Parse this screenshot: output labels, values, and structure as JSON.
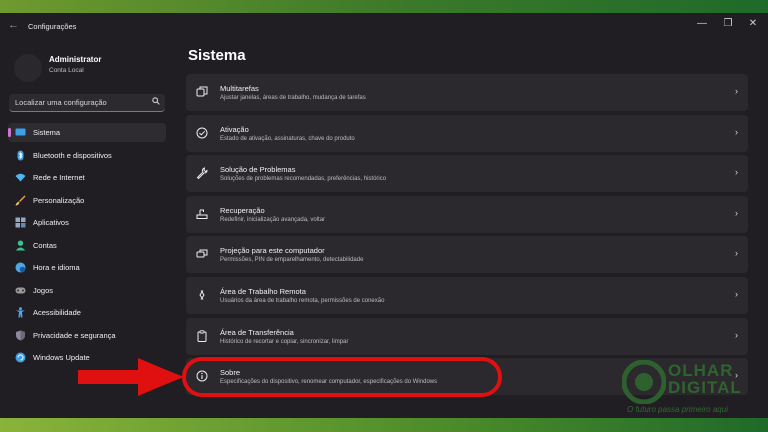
{
  "window": {
    "title": "Configurações",
    "back_glyph": "←",
    "minimize_glyph": "—",
    "maximize_glyph": "❐",
    "close_glyph": "✕"
  },
  "user": {
    "name": "Administrator",
    "account_type": "Conta Local"
  },
  "search": {
    "placeholder": "Localizar uma configuração",
    "icon": "search-icon"
  },
  "sidebar": {
    "items": [
      {
        "label": "Sistema",
        "icon": "monitor-icon",
        "color": "#3aa0e8",
        "active": true
      },
      {
        "label": "Bluetooth e dispositivos",
        "icon": "bluetooth-icon",
        "color": "#3aa0e8"
      },
      {
        "label": "Rede e Internet",
        "icon": "wifi-icon",
        "color": "#4fb6f0"
      },
      {
        "label": "Personalização",
        "icon": "brush-icon",
        "color": "#e8a04a"
      },
      {
        "label": "Aplicativos",
        "icon": "apps-icon",
        "color": "#8fa8c8"
      },
      {
        "label": "Contas",
        "icon": "person-icon",
        "color": "#3ac08a"
      },
      {
        "label": "Hora e idioma",
        "icon": "globe-clock-icon",
        "color": "#4aa8e8"
      },
      {
        "label": "Jogos",
        "icon": "gamepad-icon",
        "color": "#9a9a9a"
      },
      {
        "label": "Acessibilidade",
        "icon": "accessibility-icon",
        "color": "#4aa8e8"
      },
      {
        "label": "Privacidade e segurança",
        "icon": "shield-icon",
        "color": "#8a8a9a"
      },
      {
        "label": "Windows Update",
        "icon": "update-icon",
        "color": "#3aa0e8"
      }
    ]
  },
  "main": {
    "title": "Sistema",
    "cards": [
      {
        "title": "Multitarefas",
        "subtitle": "Ajustar janelas, áreas de trabalho, mudança de tarefas",
        "icon": "multitasking-icon"
      },
      {
        "title": "Ativação",
        "subtitle": "Estado de ativação, assinaturas, chave do produto",
        "icon": "activation-check-icon"
      },
      {
        "title": "Solução de Problemas",
        "subtitle": "Soluções de problemas recomendadas, preferências, histórico",
        "icon": "wrench-icon"
      },
      {
        "title": "Recuperação",
        "subtitle": "Redefinir, inicialização avançada, voltar",
        "icon": "recovery-icon"
      },
      {
        "title": "Projeção para este computador",
        "subtitle": "Permissões, PIN de emparelhamento, detectabilidade",
        "icon": "projection-icon"
      },
      {
        "title": "Área de Trabalho Remota",
        "subtitle": "Usuários da área de trabalho remota, permissões de conexão",
        "icon": "remote-desktop-icon"
      },
      {
        "title": "Área de Transferência",
        "subtitle": "Histórico de recortar e copiar, sincronizar, limpar",
        "icon": "clipboard-icon"
      },
      {
        "title": "Sobre",
        "subtitle": "Especificações do dispositivo, renomear computador, especificações do Windows",
        "icon": "info-icon"
      }
    ]
  },
  "watermark": {
    "line1": "OLHAR",
    "line2": "DIGITAL",
    "tagline": "O futuro passa primeiro aqui"
  },
  "colors": {
    "accent_pink": "#d070d8",
    "highlight_red": "#e01010",
    "brand_green": "#2f6b2f"
  }
}
